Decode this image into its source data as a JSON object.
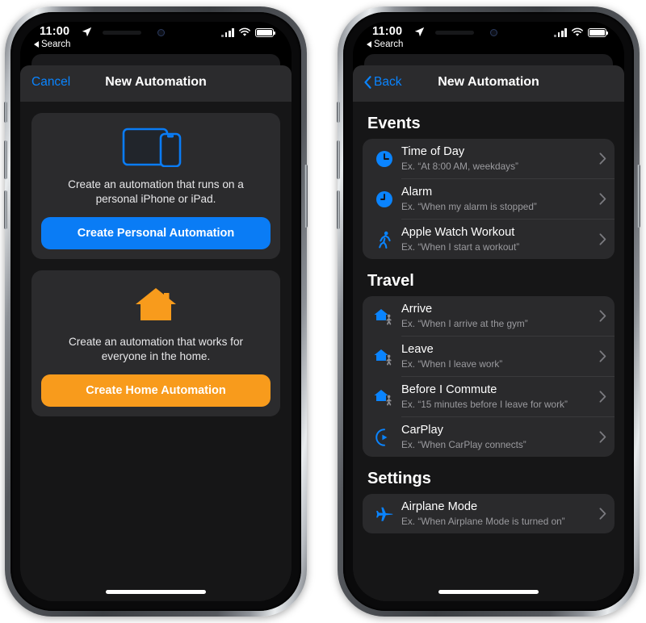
{
  "status_bar": {
    "time": "11:00",
    "back_label": "Search",
    "location_icon": "location-arrow-icon",
    "signal_icon": "cellular-bars-icon",
    "wifi_icon": "wifi-icon",
    "battery_icon": "battery-full-icon"
  },
  "colors": {
    "accent_blue": "#0a84ff",
    "button_blue": "#0a7cf5",
    "accent_orange": "#f89b1c",
    "card_bg": "#2b2b2d",
    "screen_bg": "#161617",
    "nav_bg": "#2b2b2d",
    "subtitle_gray": "#9b9b9f"
  },
  "left_phone": {
    "nav": {
      "cancel_label": "Cancel",
      "title": "New Automation"
    },
    "cards": [
      {
        "icon": "ipad-iphone-devices-icon",
        "description": "Create an automation that runs on a personal iPhone or iPad.",
        "button_label": "Create Personal Automation",
        "button_style": "blue"
      },
      {
        "icon": "house-icon",
        "description": "Create an automation that works for everyone in the home.",
        "button_label": "Create Home Automation",
        "button_style": "orange"
      }
    ]
  },
  "right_phone": {
    "nav": {
      "back_label": "Back",
      "title": "New Automation"
    },
    "sections": [
      {
        "title": "Events",
        "rows": [
          {
            "icon": "clock-icon",
            "title": "Time of Day",
            "subtitle": "Ex. “At 8:00 AM, weekdays”"
          },
          {
            "icon": "alarm-clock-icon",
            "title": "Alarm",
            "subtitle": "Ex. “When my alarm is stopped”"
          },
          {
            "icon": "runner-icon",
            "title": "Apple Watch Workout",
            "subtitle": "Ex. “When I start a workout”"
          }
        ]
      },
      {
        "title": "Travel",
        "rows": [
          {
            "icon": "house-walker-arrive-icon",
            "title": "Arrive",
            "subtitle": "Ex. “When I arrive at the gym”"
          },
          {
            "icon": "house-walker-leave-icon",
            "title": "Leave",
            "subtitle": "Ex. “When I leave work”"
          },
          {
            "icon": "house-walker-commute-icon",
            "title": "Before I Commute",
            "subtitle": "Ex. “15 minutes before I leave for work”"
          },
          {
            "icon": "carplay-icon",
            "title": "CarPlay",
            "subtitle": "Ex. “When CarPlay connects”"
          }
        ]
      },
      {
        "title": "Settings",
        "rows": [
          {
            "icon": "airplane-icon",
            "title": "Airplane Mode",
            "subtitle": "Ex. “When Airplane Mode is turned on”"
          }
        ]
      }
    ]
  }
}
